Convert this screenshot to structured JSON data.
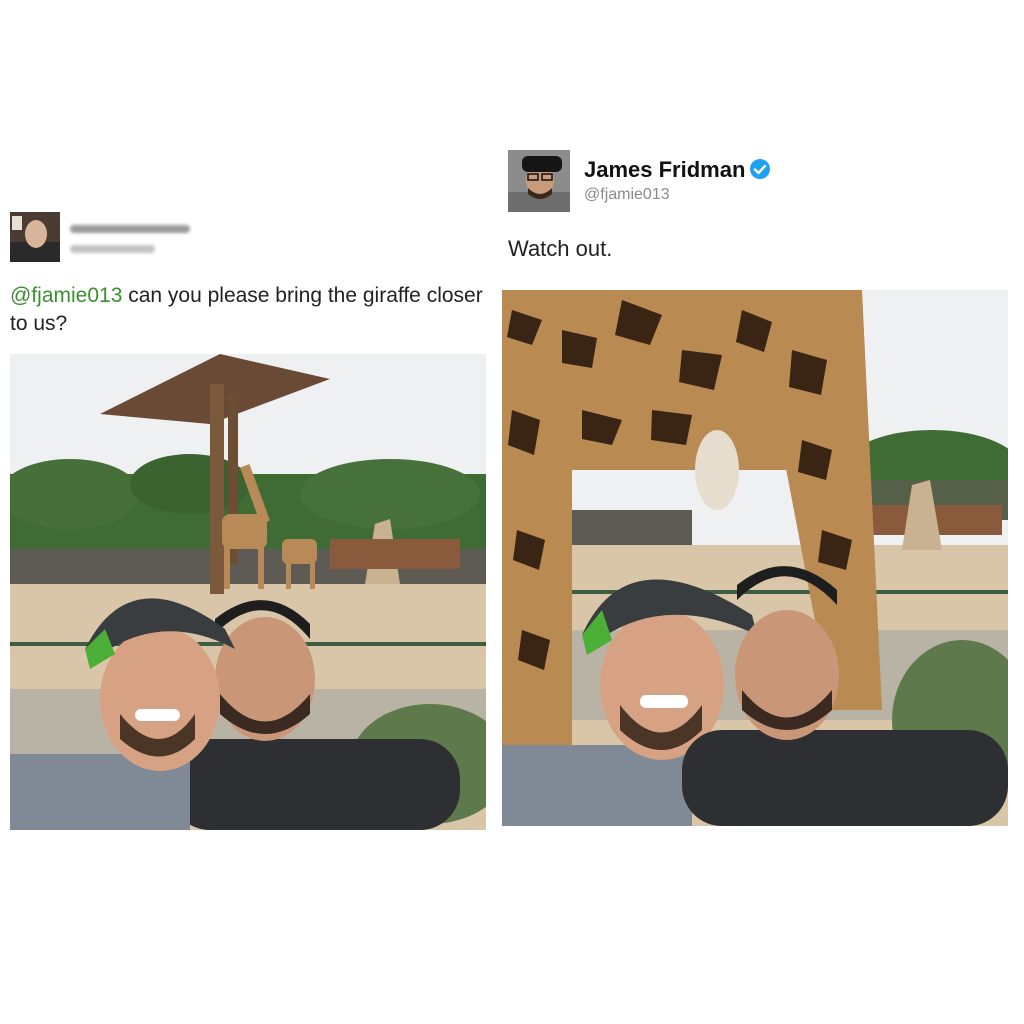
{
  "left_tweet": {
    "mention": "@fjamie013",
    "text": " can you please bring the giraffe closer to us?"
  },
  "right_tweet": {
    "display_name": "James Fridman",
    "handle": "@fjamie013",
    "text": "Watch out.",
    "verified_icon": "verified-badge-icon"
  },
  "colors": {
    "mention": "#3a8f2e",
    "verified": "#1da1f2"
  }
}
